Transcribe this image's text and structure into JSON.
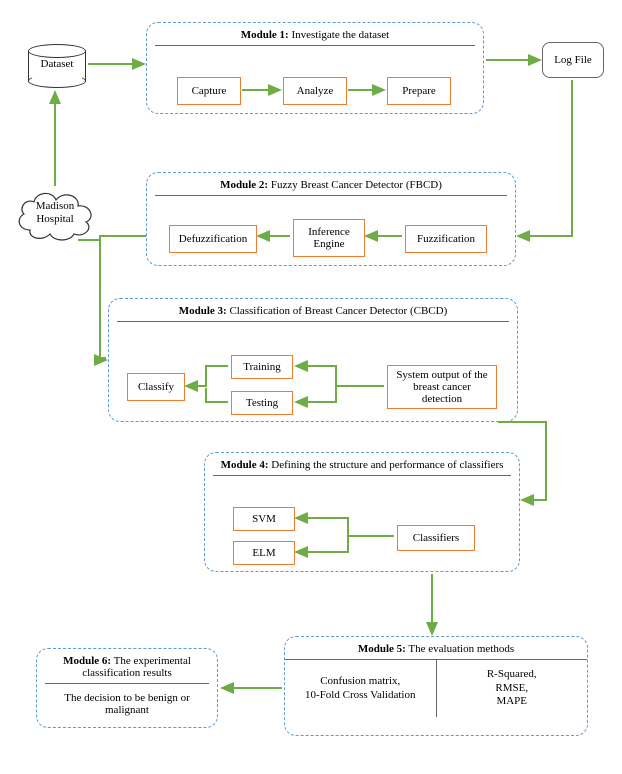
{
  "dataset": {
    "label": "Dataset"
  },
  "logfile": {
    "label": "Log File"
  },
  "cloud": {
    "label": "Madison\nHospital"
  },
  "module1": {
    "title_bold": "Module 1:",
    "title_rest": " Investigate the dataset",
    "steps": {
      "capture": "Capture",
      "analyze": "Analyze",
      "prepare": "Prepare"
    }
  },
  "module2": {
    "title_bold": "Module 2:",
    "title_rest": " Fuzzy Breast Cancer Detector (FBCD)",
    "steps": {
      "defuzz": "Defuzzification",
      "engine": "Inference\nEngine",
      "fuzz": "Fuzzification"
    }
  },
  "module3": {
    "title_bold": "Module 3:",
    "title_rest": " Classification of Breast Cancer Detector (CBCD)",
    "classify": "Classify",
    "training": "Training",
    "testing": "Testing",
    "sysout": "System output of the breast cancer detection"
  },
  "module4": {
    "title_bold": "Module 4:",
    "title_rest": " Defining the structure and performance of classifiers",
    "svm": "SVM",
    "elm": "ELM",
    "classifiers": "Classifiers"
  },
  "module5": {
    "title_bold": "Module 5:",
    "title_rest": " The evaluation methods",
    "left": "Confusion matrix,\n10-Fold Cross Validation",
    "right": "R-Squared,\nRMSE,\nMAPE"
  },
  "module6": {
    "title_bold": "Module 6:",
    "title_rest": " The experimental classification results",
    "body": "The decision to be benign or malignant"
  }
}
